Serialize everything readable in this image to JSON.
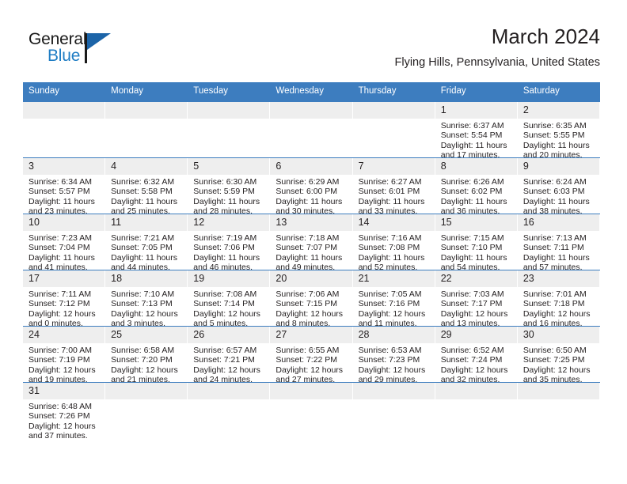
{
  "brand": {
    "name_part1": "General",
    "name_part2": "Blue"
  },
  "header": {
    "title": "March 2024",
    "location": "Flying Hills, Pennsylvania, United States"
  },
  "calendar": {
    "weekday_headers": [
      "Sunday",
      "Monday",
      "Tuesday",
      "Wednesday",
      "Thursday",
      "Friday",
      "Saturday"
    ],
    "accent_color": "#3d7dbf",
    "daynum_bg": "#eeeeee",
    "weeks": [
      [
        {
          "day": "",
          "blank": true,
          "sunrise": "",
          "sunset": "",
          "daylight1": "",
          "daylight2": ""
        },
        {
          "day": "",
          "blank": true,
          "sunrise": "",
          "sunset": "",
          "daylight1": "",
          "daylight2": ""
        },
        {
          "day": "",
          "blank": true,
          "sunrise": "",
          "sunset": "",
          "daylight1": "",
          "daylight2": ""
        },
        {
          "day": "",
          "blank": true,
          "sunrise": "",
          "sunset": "",
          "daylight1": "",
          "daylight2": ""
        },
        {
          "day": "",
          "blank": true,
          "sunrise": "",
          "sunset": "",
          "daylight1": "",
          "daylight2": ""
        },
        {
          "day": "1",
          "blank": false,
          "sunrise": "Sunrise: 6:37 AM",
          "sunset": "Sunset: 5:54 PM",
          "daylight1": "Daylight: 11 hours",
          "daylight2": "and 17 minutes."
        },
        {
          "day": "2",
          "blank": false,
          "sunrise": "Sunrise: 6:35 AM",
          "sunset": "Sunset: 5:55 PM",
          "daylight1": "Daylight: 11 hours",
          "daylight2": "and 20 minutes."
        }
      ],
      [
        {
          "day": "3",
          "blank": false,
          "sunrise": "Sunrise: 6:34 AM",
          "sunset": "Sunset: 5:57 PM",
          "daylight1": "Daylight: 11 hours",
          "daylight2": "and 23 minutes."
        },
        {
          "day": "4",
          "blank": false,
          "sunrise": "Sunrise: 6:32 AM",
          "sunset": "Sunset: 5:58 PM",
          "daylight1": "Daylight: 11 hours",
          "daylight2": "and 25 minutes."
        },
        {
          "day": "5",
          "blank": false,
          "sunrise": "Sunrise: 6:30 AM",
          "sunset": "Sunset: 5:59 PM",
          "daylight1": "Daylight: 11 hours",
          "daylight2": "and 28 minutes."
        },
        {
          "day": "6",
          "blank": false,
          "sunrise": "Sunrise: 6:29 AM",
          "sunset": "Sunset: 6:00 PM",
          "daylight1": "Daylight: 11 hours",
          "daylight2": "and 30 minutes."
        },
        {
          "day": "7",
          "blank": false,
          "sunrise": "Sunrise: 6:27 AM",
          "sunset": "Sunset: 6:01 PM",
          "daylight1": "Daylight: 11 hours",
          "daylight2": "and 33 minutes."
        },
        {
          "day": "8",
          "blank": false,
          "sunrise": "Sunrise: 6:26 AM",
          "sunset": "Sunset: 6:02 PM",
          "daylight1": "Daylight: 11 hours",
          "daylight2": "and 36 minutes."
        },
        {
          "day": "9",
          "blank": false,
          "sunrise": "Sunrise: 6:24 AM",
          "sunset": "Sunset: 6:03 PM",
          "daylight1": "Daylight: 11 hours",
          "daylight2": "and 38 minutes."
        }
      ],
      [
        {
          "day": "10",
          "blank": false,
          "sunrise": "Sunrise: 7:23 AM",
          "sunset": "Sunset: 7:04 PM",
          "daylight1": "Daylight: 11 hours",
          "daylight2": "and 41 minutes."
        },
        {
          "day": "11",
          "blank": false,
          "sunrise": "Sunrise: 7:21 AM",
          "sunset": "Sunset: 7:05 PM",
          "daylight1": "Daylight: 11 hours",
          "daylight2": "and 44 minutes."
        },
        {
          "day": "12",
          "blank": false,
          "sunrise": "Sunrise: 7:19 AM",
          "sunset": "Sunset: 7:06 PM",
          "daylight1": "Daylight: 11 hours",
          "daylight2": "and 46 minutes."
        },
        {
          "day": "13",
          "blank": false,
          "sunrise": "Sunrise: 7:18 AM",
          "sunset": "Sunset: 7:07 PM",
          "daylight1": "Daylight: 11 hours",
          "daylight2": "and 49 minutes."
        },
        {
          "day": "14",
          "blank": false,
          "sunrise": "Sunrise: 7:16 AM",
          "sunset": "Sunset: 7:08 PM",
          "daylight1": "Daylight: 11 hours",
          "daylight2": "and 52 minutes."
        },
        {
          "day": "15",
          "blank": false,
          "sunrise": "Sunrise: 7:15 AM",
          "sunset": "Sunset: 7:10 PM",
          "daylight1": "Daylight: 11 hours",
          "daylight2": "and 54 minutes."
        },
        {
          "day": "16",
          "blank": false,
          "sunrise": "Sunrise: 7:13 AM",
          "sunset": "Sunset: 7:11 PM",
          "daylight1": "Daylight: 11 hours",
          "daylight2": "and 57 minutes."
        }
      ],
      [
        {
          "day": "17",
          "blank": false,
          "sunrise": "Sunrise: 7:11 AM",
          "sunset": "Sunset: 7:12 PM",
          "daylight1": "Daylight: 12 hours",
          "daylight2": "and 0 minutes."
        },
        {
          "day": "18",
          "blank": false,
          "sunrise": "Sunrise: 7:10 AM",
          "sunset": "Sunset: 7:13 PM",
          "daylight1": "Daylight: 12 hours",
          "daylight2": "and 3 minutes."
        },
        {
          "day": "19",
          "blank": false,
          "sunrise": "Sunrise: 7:08 AM",
          "sunset": "Sunset: 7:14 PM",
          "daylight1": "Daylight: 12 hours",
          "daylight2": "and 5 minutes."
        },
        {
          "day": "20",
          "blank": false,
          "sunrise": "Sunrise: 7:06 AM",
          "sunset": "Sunset: 7:15 PM",
          "daylight1": "Daylight: 12 hours",
          "daylight2": "and 8 minutes."
        },
        {
          "day": "21",
          "blank": false,
          "sunrise": "Sunrise: 7:05 AM",
          "sunset": "Sunset: 7:16 PM",
          "daylight1": "Daylight: 12 hours",
          "daylight2": "and 11 minutes."
        },
        {
          "day": "22",
          "blank": false,
          "sunrise": "Sunrise: 7:03 AM",
          "sunset": "Sunset: 7:17 PM",
          "daylight1": "Daylight: 12 hours",
          "daylight2": "and 13 minutes."
        },
        {
          "day": "23",
          "blank": false,
          "sunrise": "Sunrise: 7:01 AM",
          "sunset": "Sunset: 7:18 PM",
          "daylight1": "Daylight: 12 hours",
          "daylight2": "and 16 minutes."
        }
      ],
      [
        {
          "day": "24",
          "blank": false,
          "sunrise": "Sunrise: 7:00 AM",
          "sunset": "Sunset: 7:19 PM",
          "daylight1": "Daylight: 12 hours",
          "daylight2": "and 19 minutes."
        },
        {
          "day": "25",
          "blank": false,
          "sunrise": "Sunrise: 6:58 AM",
          "sunset": "Sunset: 7:20 PM",
          "daylight1": "Daylight: 12 hours",
          "daylight2": "and 21 minutes."
        },
        {
          "day": "26",
          "blank": false,
          "sunrise": "Sunrise: 6:57 AM",
          "sunset": "Sunset: 7:21 PM",
          "daylight1": "Daylight: 12 hours",
          "daylight2": "and 24 minutes."
        },
        {
          "day": "27",
          "blank": false,
          "sunrise": "Sunrise: 6:55 AM",
          "sunset": "Sunset: 7:22 PM",
          "daylight1": "Daylight: 12 hours",
          "daylight2": "and 27 minutes."
        },
        {
          "day": "28",
          "blank": false,
          "sunrise": "Sunrise: 6:53 AM",
          "sunset": "Sunset: 7:23 PM",
          "daylight1": "Daylight: 12 hours",
          "daylight2": "and 29 minutes."
        },
        {
          "day": "29",
          "blank": false,
          "sunrise": "Sunrise: 6:52 AM",
          "sunset": "Sunset: 7:24 PM",
          "daylight1": "Daylight: 12 hours",
          "daylight2": "and 32 minutes."
        },
        {
          "day": "30",
          "blank": false,
          "sunrise": "Sunrise: 6:50 AM",
          "sunset": "Sunset: 7:25 PM",
          "daylight1": "Daylight: 12 hours",
          "daylight2": "and 35 minutes."
        }
      ],
      [
        {
          "day": "31",
          "blank": false,
          "sunrise": "Sunrise: 6:48 AM",
          "sunset": "Sunset: 7:26 PM",
          "daylight1": "Daylight: 12 hours",
          "daylight2": "and 37 minutes."
        },
        {
          "day": "",
          "blank": true,
          "sunrise": "",
          "sunset": "",
          "daylight1": "",
          "daylight2": ""
        },
        {
          "day": "",
          "blank": true,
          "sunrise": "",
          "sunset": "",
          "daylight1": "",
          "daylight2": ""
        },
        {
          "day": "",
          "blank": true,
          "sunrise": "",
          "sunset": "",
          "daylight1": "",
          "daylight2": ""
        },
        {
          "day": "",
          "blank": true,
          "sunrise": "",
          "sunset": "",
          "daylight1": "",
          "daylight2": ""
        },
        {
          "day": "",
          "blank": true,
          "sunrise": "",
          "sunset": "",
          "daylight1": "",
          "daylight2": ""
        },
        {
          "day": "",
          "blank": true,
          "sunrise": "",
          "sunset": "",
          "daylight1": "",
          "daylight2": ""
        }
      ]
    ]
  }
}
